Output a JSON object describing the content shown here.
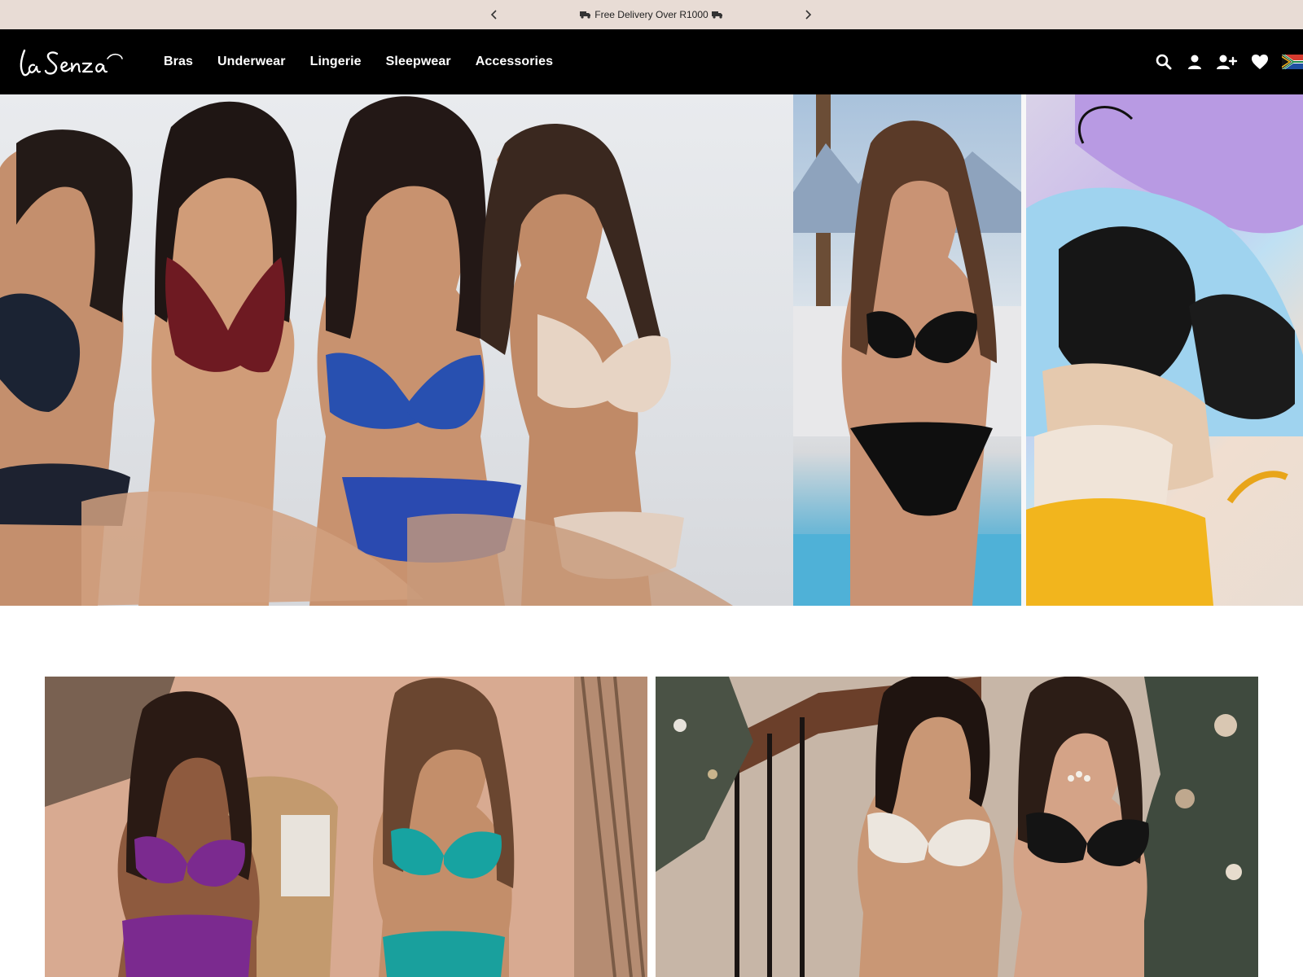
{
  "announcement": {
    "message": "Free Delivery Over R1000",
    "prev_icon": "chevron-left-icon",
    "next_icon": "chevron-right-icon"
  },
  "header": {
    "logo_text": "La Senza",
    "nav": [
      {
        "label": "Bras"
      },
      {
        "label": "Underwear"
      },
      {
        "label": "Lingerie"
      },
      {
        "label": "Sleepwear"
      },
      {
        "label": "Accessories"
      }
    ],
    "icons": [
      "search-icon",
      "account-icon",
      "add-user-icon",
      "wishlist-heart-icon",
      "south-africa-flag-icon"
    ]
  },
  "colors": {
    "announcement_bg": "#e8dcd5",
    "header_bg": "#000000",
    "nav_text": "#ffffff"
  }
}
